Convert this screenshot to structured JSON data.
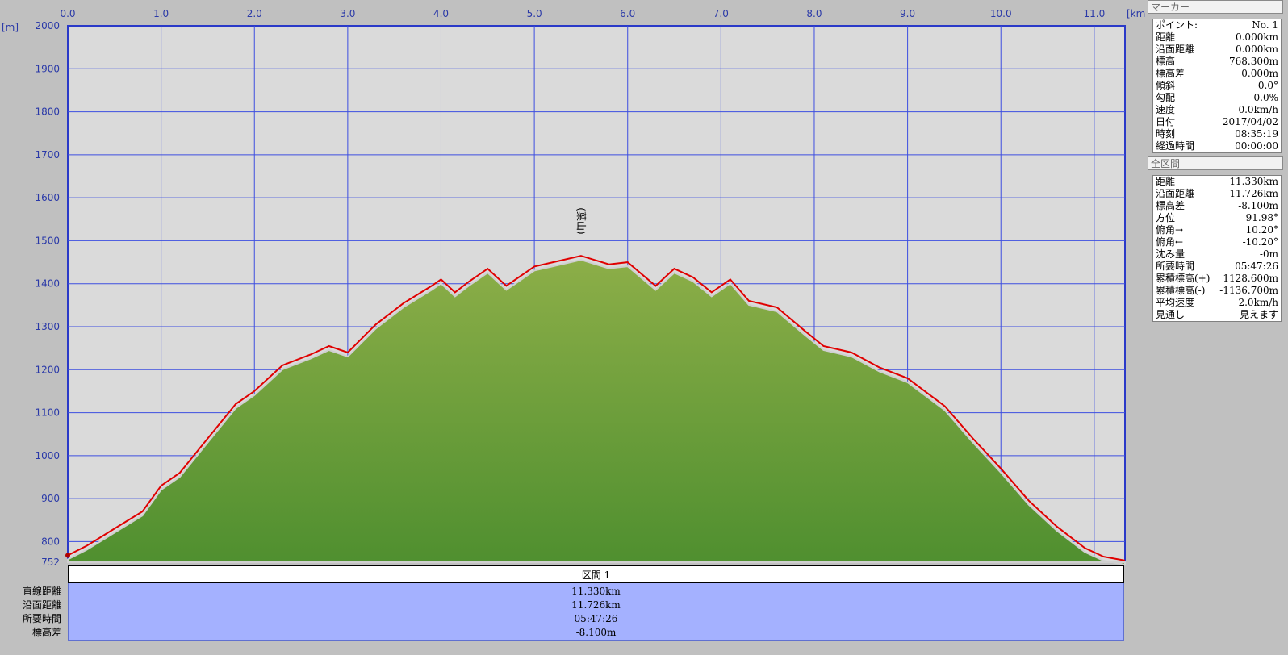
{
  "chart_data": {
    "type": "area",
    "x_unit": "[km]",
    "y_unit": "[m]",
    "x_ticks": [
      "0.0",
      "1.0",
      "2.0",
      "3.0",
      "4.0",
      "5.0",
      "6.0",
      "7.0",
      "8.0",
      "9.0",
      "10.0",
      "11.0"
    ],
    "y_ticks": [
      "2000",
      "1900",
      "1800",
      "1700",
      "1600",
      "1500",
      "1400",
      "1300",
      "1200",
      "1100",
      "1000",
      "900",
      "800",
      "752"
    ],
    "xlim": [
      0,
      11.33
    ],
    "ylim": [
      752,
      2000
    ],
    "grid": true,
    "peak_label": "(葉山)",
    "peak_label_x_km": 5.5,
    "series": [
      {
        "color": "#e00000",
        "x": [
          0,
          0.2,
          0.5,
          0.8,
          1.0,
          1.2,
          1.5,
          1.8,
          2.0,
          2.3,
          2.6,
          2.8,
          3.0,
          3.3,
          3.6,
          3.9,
          4.0,
          4.15,
          4.3,
          4.5,
          4.7,
          5.0,
          5.2,
          5.5,
          5.8,
          6.0,
          6.3,
          6.5,
          6.7,
          6.9,
          7.1,
          7.3,
          7.6,
          7.9,
          8.1,
          8.4,
          8.7,
          9.0,
          9.4,
          9.7,
          10.0,
          10.3,
          10.6,
          10.9,
          11.1,
          11.33
        ],
        "y": [
          768,
          790,
          830,
          870,
          930,
          960,
          1040,
          1120,
          1150,
          1210,
          1235,
          1255,
          1240,
          1305,
          1355,
          1395,
          1410,
          1380,
          1405,
          1435,
          1395,
          1440,
          1450,
          1465,
          1445,
          1450,
          1395,
          1435,
          1415,
          1380,
          1410,
          1360,
          1345,
          1290,
          1255,
          1240,
          1205,
          1180,
          1115,
          1040,
          970,
          895,
          835,
          785,
          765,
          756
        ]
      }
    ]
  },
  "section": {
    "header": "区間 1",
    "labels": [
      "直線距離",
      "沿面距離",
      "所要時間",
      "標高差"
    ],
    "values": [
      "11.330km",
      "11.726km",
      "05:47:26",
      "-8.100m"
    ]
  },
  "marker_panel": {
    "title": "マーカー",
    "rows": [
      {
        "label": "ポイント:",
        "value": "No. 1"
      },
      {
        "label": "距離",
        "value": "0.000km"
      },
      {
        "label": "沿面距離",
        "value": "0.000km"
      },
      {
        "label": "標高",
        "value": "768.300m"
      },
      {
        "label": "標高差",
        "value": "0.000m"
      },
      {
        "label": "傾斜",
        "value": "0.0°"
      },
      {
        "label": "勾配",
        "value": "0.0%"
      },
      {
        "label": "速度",
        "value": "0.0km/h"
      },
      {
        "label": "日付",
        "value": "2017/04/02"
      },
      {
        "label": "時刻",
        "value": "08:35:19"
      },
      {
        "label": "経過時間",
        "value": "00:00:00"
      }
    ]
  },
  "full_panel": {
    "title": "全区間",
    "rows": [
      {
        "label": "距離",
        "value": "11.330km"
      },
      {
        "label": "沿面距離",
        "value": "11.726km"
      },
      {
        "label": "標高差",
        "value": "-8.100m"
      },
      {
        "label": "方位",
        "value": "91.98°"
      },
      {
        "label": "俯角→",
        "value": "10.20°"
      },
      {
        "label": "俯角←",
        "value": "-10.20°"
      },
      {
        "label": "沈み量",
        "value": "-0m"
      },
      {
        "label": "所要時間",
        "value": "05:47:26"
      },
      {
        "label": "累積標高(+)",
        "value": "1128.600m"
      },
      {
        "label": "累積標高(-)",
        "value": "-1136.700m"
      },
      {
        "label": "平均速度",
        "value": "2.0km/h"
      },
      {
        "label": "見通し",
        "value": "見えます"
      }
    ]
  }
}
